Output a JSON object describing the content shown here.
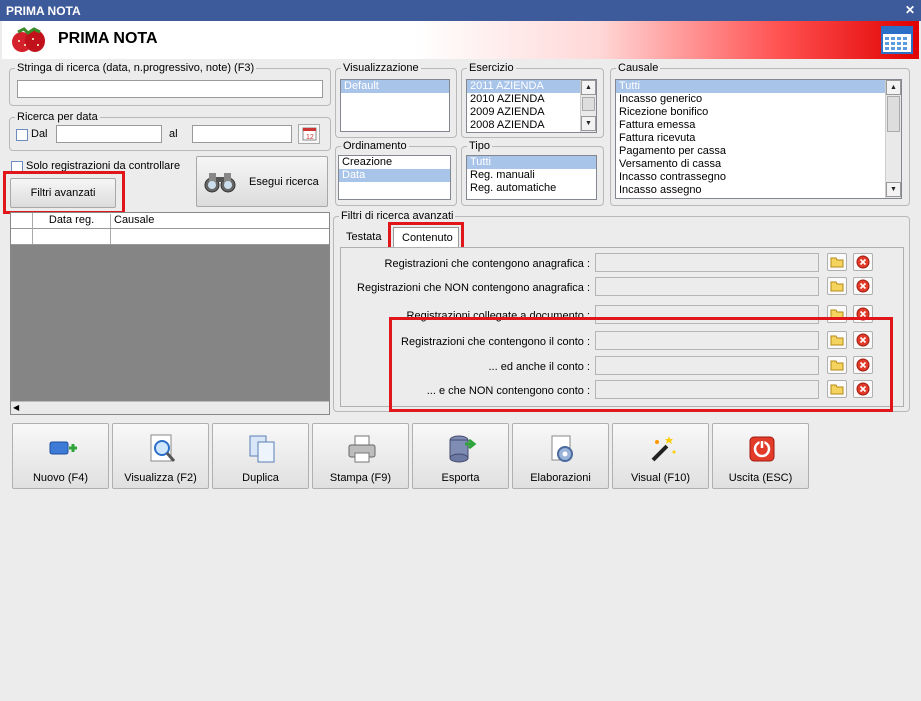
{
  "window": {
    "title": "PRIMA NOTA",
    "header_title": "PRIMA NOTA"
  },
  "search": {
    "group_label": "Stringa di ricerca (data, n.progressivo, note) (F3)",
    "value": ""
  },
  "date_search": {
    "group_label": "Ricerca per data",
    "from_label": "Dal",
    "to_label": "al",
    "from_value": "",
    "to_value": ""
  },
  "only_check_label": "Solo registrazioni da controllare",
  "advanced_filters_button": "Filtri avanzati",
  "search_button": "Esegui ricerca",
  "grid": {
    "columns": [
      "Data reg.",
      "Causale"
    ]
  },
  "visualizzazione": {
    "label": "Visualizzazione",
    "items": [
      "Default"
    ],
    "selected": 0
  },
  "ordinamento": {
    "label": "Ordinamento",
    "items": [
      "Creazione",
      "Data"
    ],
    "selected": 1
  },
  "esercizio": {
    "label": "Esercizio",
    "items": [
      "2011 AZIENDA",
      "2010 AZIENDA",
      "2009 AZIENDA",
      "2008 AZIENDA"
    ],
    "selected": 0
  },
  "tipo": {
    "label": "Tipo",
    "items": [
      "Tutti",
      "Reg. manuali",
      "Reg. automatiche"
    ],
    "selected": 0
  },
  "causale": {
    "label": "Causale",
    "items": [
      "Tutti",
      "Incasso generico",
      "Ricezione bonifico",
      "Fattura emessa",
      "Fattura ricevuta",
      "Pagamento per cassa",
      "Versamento di cassa",
      "Incasso contrassegno",
      "Incasso assegno"
    ],
    "selected": 0
  },
  "advanced": {
    "group_label": "Filtri di ricerca avanzati",
    "tabs": [
      "Testata",
      "Contenuto"
    ],
    "active_tab": "Contenuto",
    "filters": [
      {
        "label": "Registrazioni che contengono anagrafica :"
      },
      {
        "label": "Registrazioni che NON contengono anagrafica :"
      },
      {
        "label": "Registrazioni collegate a documento :"
      },
      {
        "label": "Registrazioni che contengono il conto :"
      },
      {
        "label": "... ed anche il conto :"
      },
      {
        "label": "... e che NON contengono conto :"
      }
    ]
  },
  "toolbar": {
    "buttons": [
      {
        "label": "Nuovo (F4)",
        "icon": "new-icon"
      },
      {
        "label": "Visualizza (F2)",
        "icon": "view-icon"
      },
      {
        "label": "Duplica",
        "icon": "duplicate-icon"
      },
      {
        "label": "Stampa (F9)",
        "icon": "printer-icon"
      },
      {
        "label": "Esporta",
        "icon": "export-icon"
      },
      {
        "label": "Elaborazioni",
        "icon": "process-icon"
      },
      {
        "label": "Visual (F10)",
        "icon": "magic-wand-icon"
      },
      {
        "label": "Uscita (ESC)",
        "icon": "exit-icon"
      }
    ]
  },
  "colors": {
    "title_bar": "#3d5a9a",
    "highlight": "#e0161b",
    "selection": "#3399ff"
  }
}
